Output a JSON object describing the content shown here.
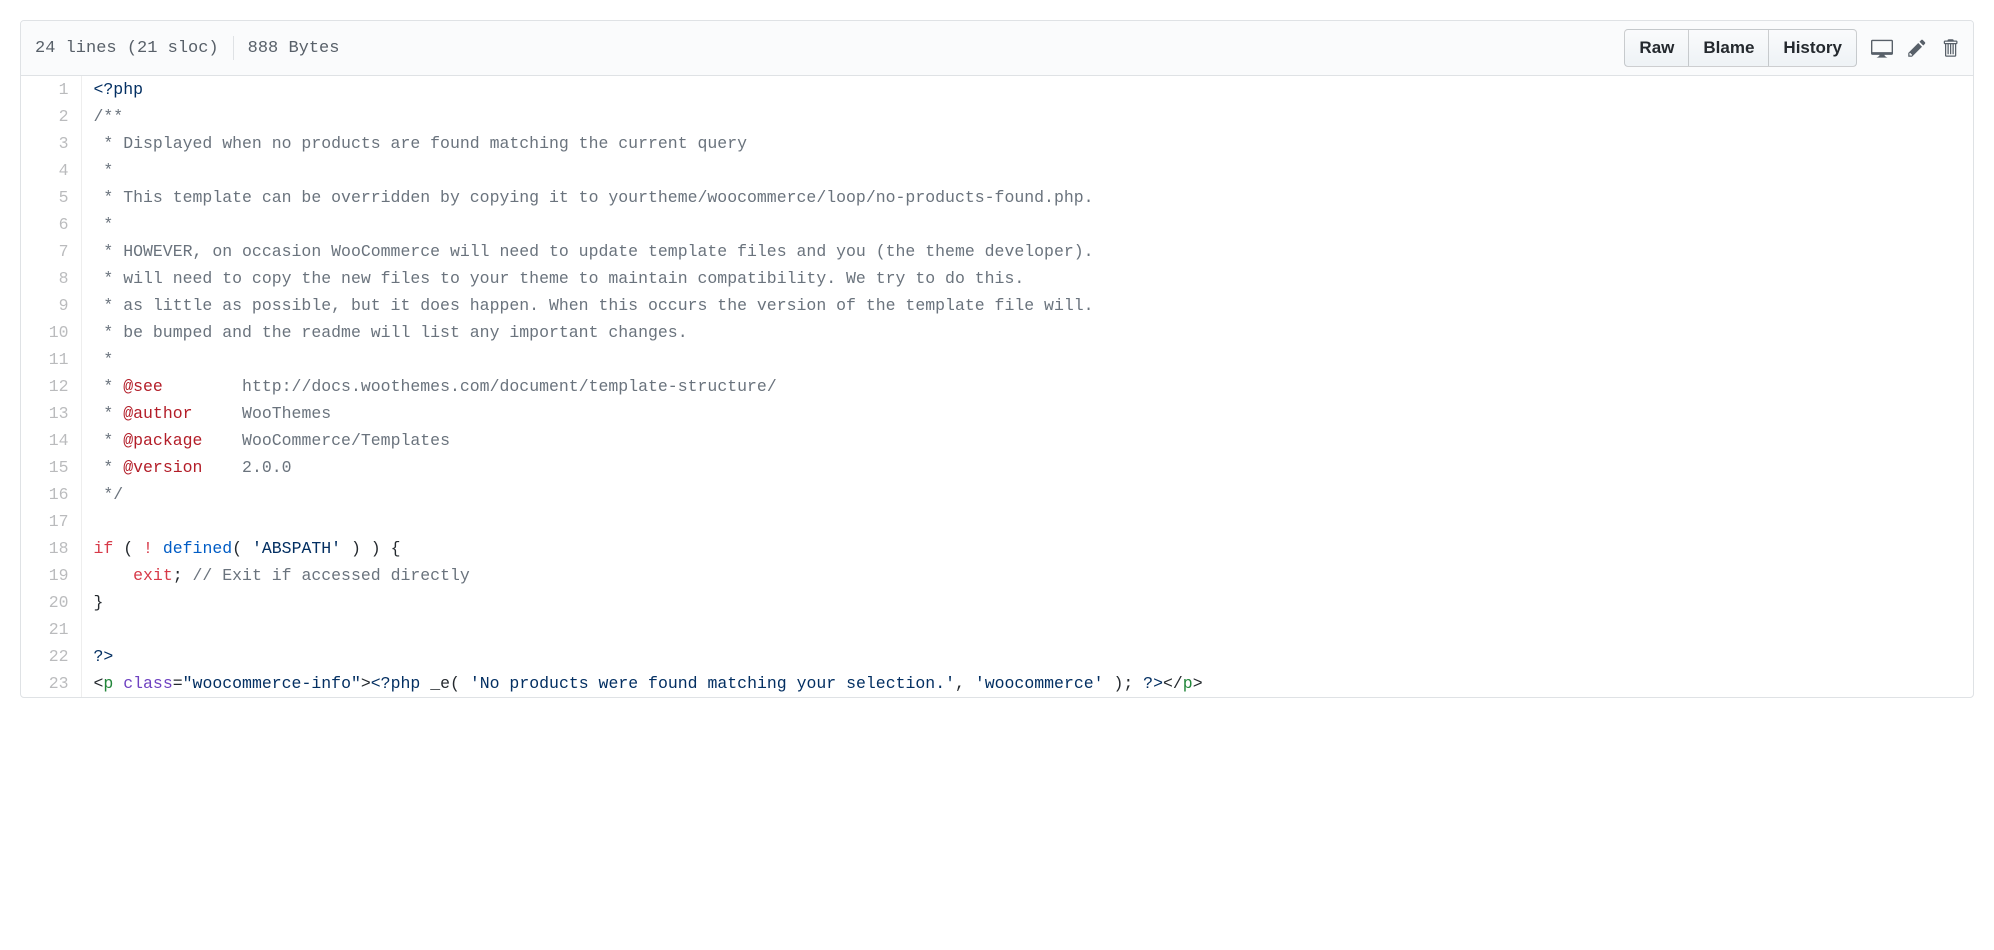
{
  "header": {
    "lines_info": "24 lines (21 sloc)",
    "bytes_info": "888 Bytes",
    "buttons": {
      "raw": "Raw",
      "blame": "Blame",
      "history": "History"
    },
    "icons": {
      "desktop": "desktop-icon",
      "pencil": "pencil-icon",
      "trash": "trash-icon"
    }
  },
  "code": {
    "line_numbers": [
      "1",
      "2",
      "3",
      "4",
      "5",
      "6",
      "7",
      "8",
      "9",
      "10",
      "11",
      "12",
      "13",
      "14",
      "15",
      "16",
      "17",
      "18",
      "19",
      "20",
      "21",
      "22",
      "23"
    ],
    "l1_open": "<?php",
    "l2": "/**",
    "l3": " * Displayed when no products are found matching the current query",
    "l4": " *",
    "l5": " * This template can be overridden by copying it to yourtheme/woocommerce/loop/no-products-found.php.",
    "l6": " *",
    "l7": " * HOWEVER, on occasion WooCommerce will need to update template files and you (the theme developer).",
    "l8": " * will need to copy the new files to your theme to maintain compatibility. We try to do this.",
    "l9": " * as little as possible, but it does happen. When this occurs the version of the template file will.",
    "l10": " * be bumped and the readme will list any important changes.",
    "l11": " *",
    "l12_pre": " * ",
    "l12_tag": "@see",
    "l12_rest": "        http://docs.woothemes.com/document/template-structure/",
    "l13_pre": " * ",
    "l13_tag": "@author",
    "l13_rest": "     WooThemes",
    "l14_pre": " * ",
    "l14_tag": "@package",
    "l14_rest": "    WooCommerce/Templates",
    "l15_pre": " * ",
    "l15_tag": "@version",
    "l15_rest": "    2.0.0",
    "l16": " */",
    "l17": "",
    "l18_if": "if",
    "l18_sp1": " ( ",
    "l18_not": "!",
    "l18_sp2": " ",
    "l18_fn": "defined",
    "l18_sp3": "( ",
    "l18_str": "'ABSPATH'",
    "l18_rest": " ) ) {",
    "l19_indent": "    ",
    "l19_exit": "exit",
    "l19_semi": "; ",
    "l19_cmt": "// Exit if accessed directly",
    "l20": "}",
    "l21": "",
    "l22": "?>",
    "l23_open": "<",
    "l23_p": "p",
    "l23_sp": " ",
    "l23_attr": "class",
    "l23_eq": "=",
    "l23_val": "\"woocommerce-info\"",
    "l23_close1": ">",
    "l23_php_open": "<?php",
    "l23_sp2": " ",
    "l23_fn": "_e",
    "l23_paren": "( ",
    "l23_str1": "'No products were found matching your selection.'",
    "l23_comma": ", ",
    "l23_str2": "'woocommerce'",
    "l23_paren2": " ); ",
    "l23_php_close": "?>",
    "l23_close_open": "</",
    "l23_p2": "p",
    "l23_close2": ">"
  }
}
